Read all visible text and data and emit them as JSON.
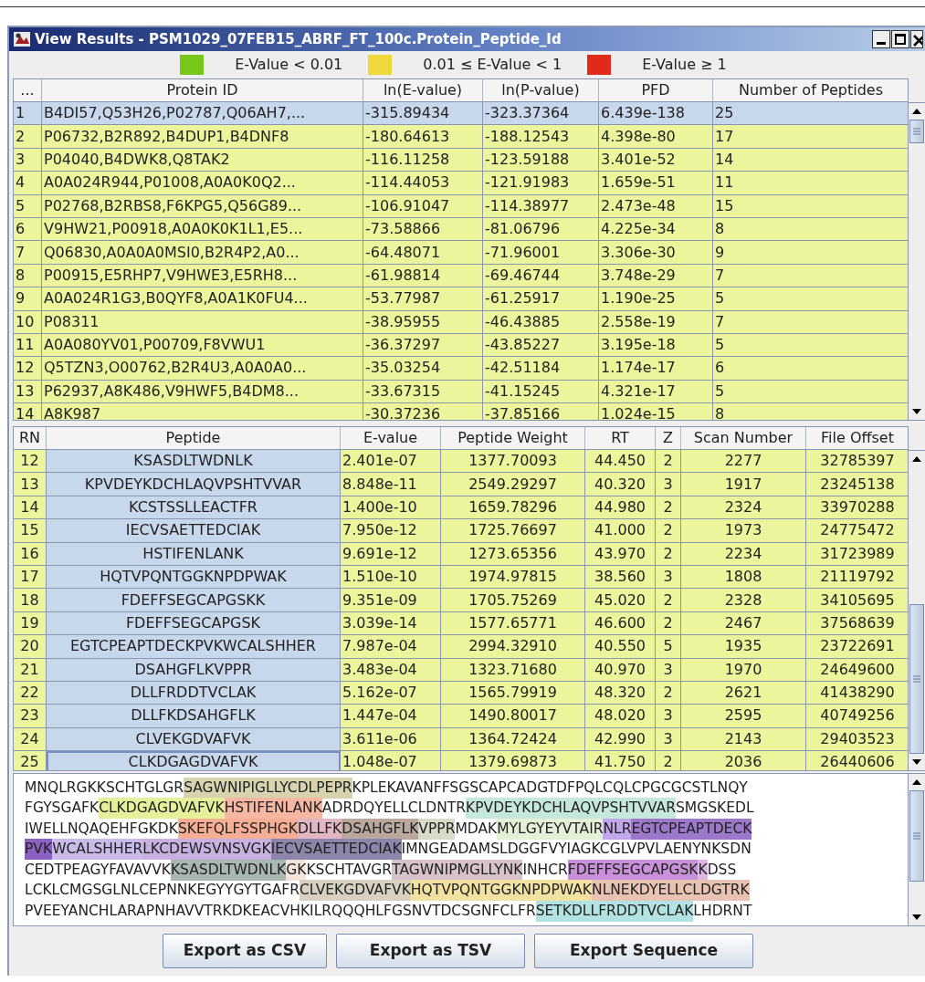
{
  "window": {
    "title": "View Results - PSM1029_07FEB15_ABRF_FT_100c.Protein_Peptide_Id"
  },
  "legend": [
    {
      "label": "E-Value < 0.01",
      "color": "#77c61a"
    },
    {
      "label": "0.01 ≤ E-Value < 1",
      "color": "#f0d83c"
    },
    {
      "label": "E-Value ≥ 1",
      "color": "#e02a1a"
    }
  ],
  "protein_table": {
    "columns": [
      "...",
      "Protein ID",
      "ln(E-value)",
      "ln(P-value)",
      "PFD",
      "Number of Peptides"
    ],
    "rows": [
      {
        "cells": [
          "1",
          "B4DI57,Q53H26,P02787,Q06AH7,...",
          "-315.89434",
          "-323.37364",
          "6.439e-138",
          "25"
        ],
        "selected": true
      },
      {
        "cells": [
          "2",
          "P06732,B2R892,B4DUP1,B4DNF8",
          "-180.64613",
          "-188.12543",
          "4.398e-80",
          "17"
        ],
        "selected": false
      },
      {
        "cells": [
          "3",
          "P04040,B4DWK8,Q8TAK2",
          "-116.11258",
          "-123.59188",
          "3.401e-52",
          "14"
        ],
        "selected": false
      },
      {
        "cells": [
          "4",
          "A0A024R944,P01008,A0A0K0Q2...",
          "-114.44053",
          "-121.91983",
          "1.659e-51",
          "11"
        ],
        "selected": false
      },
      {
        "cells": [
          "5",
          "P02768,B2RBS8,F6KPG5,Q56G89...",
          "-106.91047",
          "-114.38977",
          "2.473e-48",
          "15"
        ],
        "selected": false
      },
      {
        "cells": [
          "6",
          "V9HW21,P00918,A0A0K0K1L1,E5...",
          "-73.58866",
          "-81.06796",
          "4.225e-34",
          "8"
        ],
        "selected": false
      },
      {
        "cells": [
          "7",
          "Q06830,A0A0A0MSI0,B2R4P2,A0...",
          "-64.48071",
          "-71.96001",
          "3.306e-30",
          "9"
        ],
        "selected": false
      },
      {
        "cells": [
          "8",
          "P00915,E5RHP7,V9HWE3,E5RH8...",
          "-61.98814",
          "-69.46744",
          "3.748e-29",
          "7"
        ],
        "selected": false
      },
      {
        "cells": [
          "9",
          "A0A024R1G3,B0QYF8,A0A1K0FU4...",
          "-53.77987",
          "-61.25917",
          "1.190e-25",
          "5"
        ],
        "selected": false
      },
      {
        "cells": [
          "10",
          "P08311",
          "-38.95955",
          "-46.43885",
          "2.558e-19",
          "7"
        ],
        "selected": false
      },
      {
        "cells": [
          "11",
          "A0A080YV01,P00709,F8VWU1",
          "-36.37297",
          "-43.85227",
          "3.195e-18",
          "5"
        ],
        "selected": false
      },
      {
        "cells": [
          "12",
          "Q5TZN3,O00762,B2R4U3,A0A0A0...",
          "-35.03254",
          "-42.51184",
          "1.174e-17",
          "6"
        ],
        "selected": false
      },
      {
        "cells": [
          "13",
          "P62937,A8K486,V9HWF5,B4DM8...",
          "-33.67315",
          "-41.15245",
          "4.321e-17",
          "5"
        ],
        "selected": false
      },
      {
        "cells": [
          "14",
          "A8K987",
          "-30.37236",
          "-37.85166",
          "1.024e-15",
          "8"
        ],
        "selected": false
      }
    ]
  },
  "peptide_table": {
    "columns": [
      "RN",
      "Peptide",
      "E-value",
      "Peptide Weight",
      "RT",
      "Z",
      "Scan Number",
      "File Offset"
    ],
    "rows": [
      {
        "cells": [
          "12",
          "KSASDLTWDNLK",
          "2.401e-07",
          "1377.70093",
          "44.450",
          "2",
          "2277",
          "32785397"
        ],
        "focused": false
      },
      {
        "cells": [
          "13",
          "KPVDEYKDCHLAQVPSHTVVAR",
          "8.848e-11",
          "2549.29297",
          "40.320",
          "3",
          "1917",
          "23245138"
        ],
        "focused": false
      },
      {
        "cells": [
          "14",
          "KCSTSSLLEACTFR",
          "1.400e-10",
          "1659.78296",
          "44.980",
          "2",
          "2324",
          "33970288"
        ],
        "focused": false
      },
      {
        "cells": [
          "15",
          "IECVSAETTEDCIAK",
          "7.950e-12",
          "1725.76697",
          "41.000",
          "2",
          "1973",
          "24775472"
        ],
        "focused": false
      },
      {
        "cells": [
          "16",
          "HSTIFENLANK",
          "9.691e-12",
          "1273.65356",
          "43.970",
          "2",
          "2234",
          "31723989"
        ],
        "focused": false
      },
      {
        "cells": [
          "17",
          "HQTVPQNTGGKNPDPWAK",
          "1.510e-10",
          "1974.97815",
          "38.560",
          "3",
          "1808",
          "21119792"
        ],
        "focused": false
      },
      {
        "cells": [
          "18",
          "FDEFFSEGCAPGSKK",
          "9.351e-09",
          "1705.75269",
          "45.020",
          "2",
          "2328",
          "34105695"
        ],
        "focused": false
      },
      {
        "cells": [
          "19",
          "FDEFFSEGCAPGSK",
          "3.039e-14",
          "1577.65771",
          "46.600",
          "2",
          "2467",
          "37568639"
        ],
        "focused": false
      },
      {
        "cells": [
          "20",
          "EGTCPEAPTDECKPVKWCALSHHER",
          "7.987e-04",
          "2994.32910",
          "40.550",
          "5",
          "1935",
          "23722691"
        ],
        "focused": false
      },
      {
        "cells": [
          "21",
          "DSAHGFLKVPPR",
          "3.483e-04",
          "1323.71680",
          "40.970",
          "3",
          "1970",
          "24649600"
        ],
        "focused": false
      },
      {
        "cells": [
          "22",
          "DLLFRDDTVCLAK",
          "5.162e-07",
          "1565.79919",
          "48.320",
          "2",
          "2621",
          "41438290"
        ],
        "focused": false
      },
      {
        "cells": [
          "23",
          "DLLFKDSAHGFLK",
          "1.447e-04",
          "1490.80017",
          "48.020",
          "3",
          "2595",
          "40749256"
        ],
        "focused": false
      },
      {
        "cells": [
          "24",
          "CLVEKGDVAFVK",
          "3.611e-06",
          "1364.72424",
          "42.990",
          "3",
          "2143",
          "29403523"
        ],
        "focused": false
      },
      {
        "cells": [
          "25",
          "CLKDGAGDVAFVK",
          "1.048e-07",
          "1379.69873",
          "41.750",
          "2",
          "2036",
          "26440606"
        ],
        "focused": true
      }
    ]
  },
  "sequence": {
    "lines": [
      [
        {
          "text": "MNQLRGKKSCHTGLGR"
        },
        {
          "text": "SAGWNIPIGLLYCDLPEPR",
          "color": "#d6d3ae"
        },
        {
          "text": "KPLEKAVANFFSGSCAPCADGTDFPQLCQLCPGCGCSTLNQY"
        }
      ],
      [
        {
          "text": "FGYSGAFK"
        },
        {
          "text": "CLKDGAGDVAFVK",
          "color": "#e6f09a"
        },
        {
          "text": "HSTIFENLANK",
          "color": "#f6b8a2"
        },
        {
          "text": "ADRDQYELLCLDNTR"
        },
        {
          "text": "KPVDEYKDCHLAQVPSHTVVAR",
          "color": "#c6e8da"
        },
        {
          "text": "SMGSKEDL"
        }
      ],
      [
        {
          "text": "IWELLNQAQEHFGKDK"
        },
        {
          "text": "SKEFQLFSSPHGK",
          "color": "#f6ae94"
        },
        {
          "text": "DLLFK",
          "color": "#e2b6c2"
        },
        {
          "text": "DSAHGFLK",
          "color": "#baa89e"
        },
        {
          "text": "VPPR",
          "color": "#d6dcc8"
        },
        {
          "text": "MDAK"
        },
        {
          "text": "MYLGYEYVTAIR",
          "color": "#e4f0d8"
        },
        {
          "text": "NLR",
          "color": "#c2a8ea"
        },
        {
          "text": "EGTCPEAPTDECK",
          "color": "#9c78ca"
        }
      ],
      [
        {
          "text": "PVK",
          "color": "#8a60c0"
        },
        {
          "text": "WCALSHHER",
          "color": "#cabaea"
        },
        {
          "text": "LKCDEWSVNSVGK",
          "color": "#c8b0e0"
        },
        {
          "text": "IECVSAETTEDCIAK",
          "color": "#8e86aa"
        },
        {
          "text": "IMNGEADAMSLDGGFVYIAGKCGLVPVLAENYNKSDN"
        }
      ],
      [
        {
          "text": "CEDTPEAGYFAVAVVK"
        },
        {
          "text": "KSASDLTWDNLK",
          "color": "#a8b8b0"
        },
        {
          "text": "GK",
          "color": "#f4e4dc"
        },
        {
          "text": "KSCHTAVGR"
        },
        {
          "text": "TAGWNIPMGLLYNK",
          "color": "#d8c2ca"
        },
        {
          "text": "INHCR"
        },
        {
          "text": "FDEFFSEGCAPGSK",
          "color": "#c890d8"
        },
        {
          "text": "K",
          "color": "#dcb8e6"
        },
        {
          "text": "DSS"
        }
      ],
      [
        {
          "text": "LCKLCMGSGLNLCEPNNKEGYYGYTGAFR"
        },
        {
          "text": "CLVEKGDVAFVK",
          "color": "#d8d0c0"
        },
        {
          "text": "HQTVPQNTGGKNPDPWAK",
          "color": "#f2e2a2"
        },
        {
          "text": "NLNEKDYELLCLDGTRK",
          "color": "#e8c2b2"
        }
      ],
      [
        {
          "text": "PVEEYANCHLARAPNHAVVTRKDKEACVHKILRQQQHLFGSNVTDCSGNFCLFR"
        },
        {
          "text": "SETKDLLFRDDTVCLAK",
          "color": "#b2e2e2"
        },
        {
          "text": "LHDRNT"
        }
      ]
    ]
  },
  "buttons": [
    "Export as CSV",
    "Export as TSV",
    "Export Sequence"
  ]
}
